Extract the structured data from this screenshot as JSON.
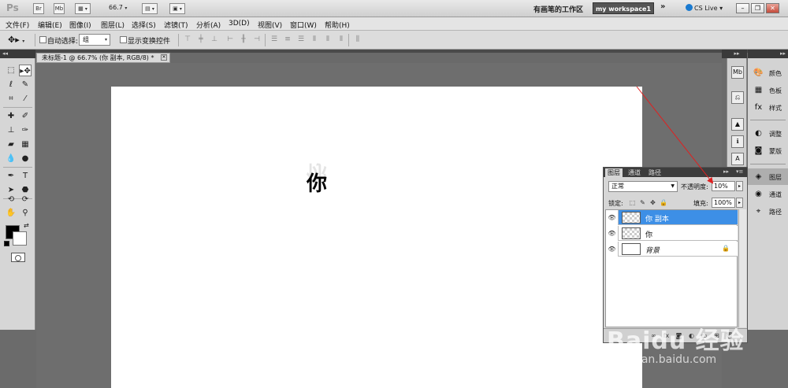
{
  "app": {
    "logo": "Ps",
    "bridge_label": "Br",
    "mini_bridge_label": "Mb",
    "zoom": "66.7",
    "workspace_name": "有画笔的工作区",
    "workspace_button": "my workspace1",
    "more_glyph": "»",
    "cs_live": "CS Live"
  },
  "menu": [
    "文件(F)",
    "编辑(E)",
    "图像(I)",
    "图层(L)",
    "选择(S)",
    "滤镜(T)",
    "分析(A)",
    "3D(D)",
    "视图(V)",
    "窗口(W)",
    "帮助(H)"
  ],
  "options": {
    "auto_select_label": "自动选择:",
    "auto_select_value": "组",
    "show_transform_label": "显示变换控件"
  },
  "document": {
    "tab_title": "未标题-1 @ 66.7% (你 副本, RGB/8) *",
    "canvas_glyph": "你"
  },
  "right_panels": [
    {
      "icon": "palette-icon",
      "label": "颜色"
    },
    {
      "icon": "swatches-icon",
      "label": "色板"
    },
    {
      "icon": "styles-icon",
      "label": "样式"
    },
    {
      "icon": "adjustments-icon",
      "label": "调整"
    },
    {
      "icon": "masks-icon",
      "label": "蒙版"
    },
    {
      "icon": "layers-icon",
      "label": "图层"
    },
    {
      "icon": "channels-icon",
      "label": "通道"
    },
    {
      "icon": "paths-icon",
      "label": "路径"
    }
  ],
  "layers_panel": {
    "tabs": [
      "图层",
      "通道",
      "路径"
    ],
    "blend_mode": "正常",
    "opacity_label": "不透明度:",
    "opacity_value": "10%",
    "lock_label": "锁定:",
    "fill_label": "填充:",
    "fill_value": "100%",
    "layers": [
      {
        "name": "你 副本",
        "selected": true,
        "locked": false
      },
      {
        "name": "你",
        "selected": false,
        "locked": false
      },
      {
        "name": "背景",
        "selected": false,
        "locked": true
      }
    ]
  },
  "watermark": {
    "brand": "Baidu 经验",
    "url": "jingyan.baidu.com"
  },
  "colors": {
    "selection_blue": "#3d8fe6",
    "workspace_button_bg": "#555555",
    "annotation_arrow": "#e02020"
  }
}
